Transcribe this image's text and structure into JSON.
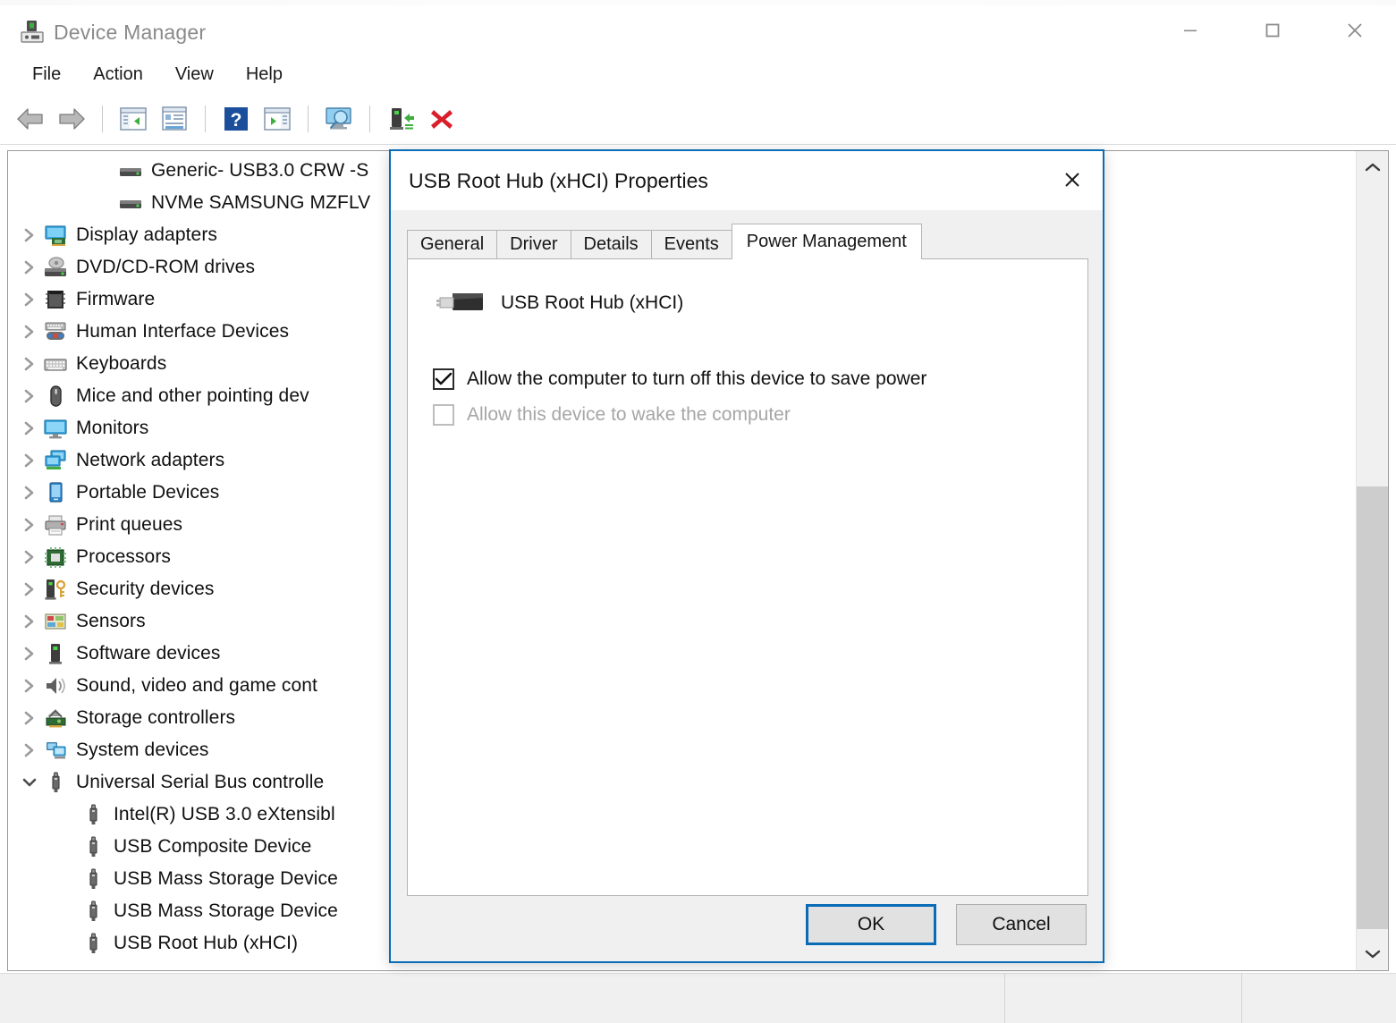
{
  "window": {
    "title": "Device Manager",
    "icon": "device-manager-icon",
    "controls": {
      "minimize": "minimize-icon",
      "maximize": "maximize-icon",
      "close": "close-icon"
    }
  },
  "menubar": {
    "items": [
      {
        "label": "File",
        "name": "menu-file"
      },
      {
        "label": "Action",
        "name": "menu-action"
      },
      {
        "label": "View",
        "name": "menu-view"
      },
      {
        "label": "Help",
        "name": "menu-help"
      }
    ]
  },
  "toolbar": {
    "buttons": [
      {
        "icon": "back-arrow-icon",
        "name": "toolbar-back"
      },
      {
        "icon": "forward-arrow-icon",
        "name": "toolbar-forward"
      },
      {
        "icon": "separator",
        "name": "toolbar-separator-1"
      },
      {
        "icon": "show-hide-console-tree-icon",
        "name": "toolbar-show-hide-tree"
      },
      {
        "icon": "properties-icon",
        "name": "toolbar-properties"
      },
      {
        "icon": "separator",
        "name": "toolbar-separator-2"
      },
      {
        "icon": "help-icon",
        "name": "toolbar-help"
      },
      {
        "icon": "update-driver-icon",
        "name": "toolbar-update-driver"
      },
      {
        "icon": "separator",
        "name": "toolbar-separator-3"
      },
      {
        "icon": "scan-for-hardware-changes-icon",
        "name": "toolbar-scan-hardware"
      },
      {
        "icon": "separator",
        "name": "toolbar-separator-4"
      },
      {
        "icon": "add-legacy-hardware-icon",
        "name": "toolbar-add-legacy-hardware"
      },
      {
        "icon": "uninstall-device-icon",
        "name": "toolbar-uninstall-device"
      }
    ]
  },
  "tree": {
    "items": [
      {
        "label": "Generic- USB3.0 CRW   -S",
        "icon": "disk-drive-icon",
        "level": 3,
        "expander": "none"
      },
      {
        "label": "NVMe SAMSUNG MZFLV",
        "icon": "disk-drive-icon",
        "level": 3,
        "expander": "none"
      },
      {
        "label": "Display adapters",
        "icon": "display-adapter-icon",
        "level": 1,
        "expander": "collapsed"
      },
      {
        "label": "DVD/CD-ROM drives",
        "icon": "dvd-drive-icon",
        "level": 1,
        "expander": "collapsed"
      },
      {
        "label": "Firmware",
        "icon": "firmware-icon",
        "level": 1,
        "expander": "collapsed"
      },
      {
        "label": "Human Interface Devices",
        "icon": "hid-icon",
        "level": 1,
        "expander": "collapsed"
      },
      {
        "label": "Keyboards",
        "icon": "keyboard-icon",
        "level": 1,
        "expander": "collapsed"
      },
      {
        "label": "Mice and other pointing dev",
        "icon": "mouse-icon",
        "level": 1,
        "expander": "collapsed"
      },
      {
        "label": "Monitors",
        "icon": "monitor-icon",
        "level": 1,
        "expander": "collapsed"
      },
      {
        "label": "Network adapters",
        "icon": "network-adapter-icon",
        "level": 1,
        "expander": "collapsed"
      },
      {
        "label": "Portable Devices",
        "icon": "portable-device-icon",
        "level": 1,
        "expander": "collapsed"
      },
      {
        "label": "Print queues",
        "icon": "printer-icon",
        "level": 1,
        "expander": "collapsed"
      },
      {
        "label": "Processors",
        "icon": "processor-icon",
        "level": 1,
        "expander": "collapsed"
      },
      {
        "label": "Security devices",
        "icon": "security-device-icon",
        "level": 1,
        "expander": "collapsed"
      },
      {
        "label": "Sensors",
        "icon": "sensor-icon",
        "level": 1,
        "expander": "collapsed"
      },
      {
        "label": "Software devices",
        "icon": "software-device-icon",
        "level": 1,
        "expander": "collapsed"
      },
      {
        "label": "Sound, video and game cont",
        "icon": "speaker-icon",
        "level": 1,
        "expander": "collapsed"
      },
      {
        "label": "Storage controllers",
        "icon": "storage-controller-icon",
        "level": 1,
        "expander": "collapsed"
      },
      {
        "label": "System devices",
        "icon": "system-device-icon",
        "level": 1,
        "expander": "collapsed"
      },
      {
        "label": "Universal Serial Bus controlle",
        "icon": "usb-icon",
        "level": 1,
        "expander": "expanded"
      },
      {
        "label": "Intel(R) USB 3.0 eXtensibl",
        "icon": "usb-icon",
        "level": 2,
        "expander": "none"
      },
      {
        "label": "USB Composite Device",
        "icon": "usb-icon",
        "level": 2,
        "expander": "none"
      },
      {
        "label": "USB Mass Storage Device",
        "icon": "usb-icon",
        "level": 2,
        "expander": "none"
      },
      {
        "label": "USB Mass Storage Device",
        "icon": "usb-icon",
        "level": 2,
        "expander": "none"
      },
      {
        "label": "USB Root Hub (xHCI)",
        "icon": "usb-icon",
        "level": 2,
        "expander": "none"
      }
    ],
    "scrollbar": {
      "up_arrow": "chevron-up-icon",
      "down_arrow": "chevron-down-icon"
    }
  },
  "dialog": {
    "title": "USB Root Hub (xHCI) Properties",
    "close_icon": "close-icon",
    "tabs": [
      {
        "label": "General",
        "name": "tab-general",
        "active": false
      },
      {
        "label": "Driver",
        "name": "tab-driver",
        "active": false
      },
      {
        "label": "Details",
        "name": "tab-details",
        "active": false
      },
      {
        "label": "Events",
        "name": "tab-events",
        "active": false
      },
      {
        "label": "Power Management",
        "name": "tab-power-management",
        "active": true
      }
    ],
    "device": {
      "icon": "usb-plug-icon",
      "name": "USB Root Hub (xHCI)"
    },
    "checkboxes": [
      {
        "label": "Allow the computer to turn off this device to save power",
        "checked": true,
        "disabled": false,
        "name": "allow-turn-off-device-checkbox"
      },
      {
        "label": "Allow this device to wake the computer",
        "checked": false,
        "disabled": true,
        "name": "allow-wake-computer-checkbox"
      }
    ],
    "buttons": {
      "ok": "OK",
      "cancel": "Cancel"
    }
  },
  "statusbar": {
    "cell1": "",
    "cell2": "",
    "cell3": ""
  },
  "colors": {
    "accent": "#0a6cb7",
    "titlebar_text": "#8a8a8a",
    "dialog_bg": "#f0f0f0",
    "panel_bg": "#ffffff",
    "close_hover": "#e81123"
  }
}
